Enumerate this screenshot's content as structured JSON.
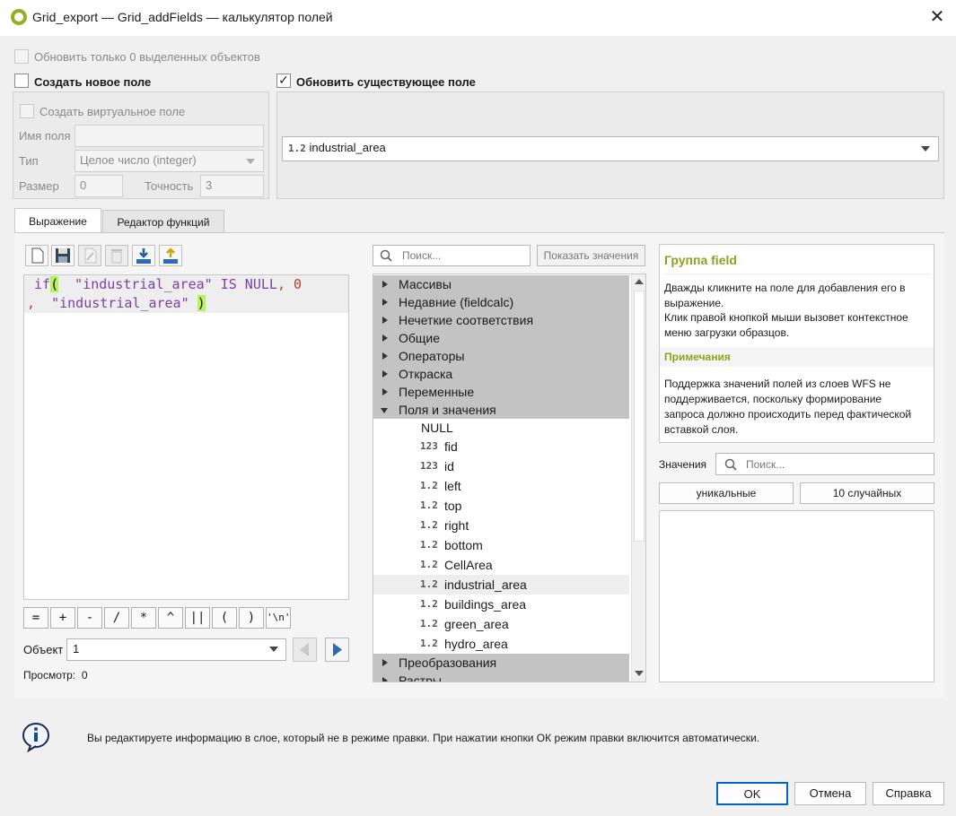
{
  "window": {
    "title": "Grid_export — Grid_addFields — калькулятор полей",
    "close_glyph": "✕"
  },
  "top": {
    "update_selected_label": "Обновить только 0 выделенных объектов",
    "create_new_field_label": "Создать новое поле",
    "update_existing_label": "Обновить существующее поле",
    "update_existing_checkmark": "✓"
  },
  "new_field": {
    "virtual_label": "Создать виртуальное поле",
    "name_label": "Имя поля",
    "name_value": "",
    "type_label": "Тип",
    "type_value": "Целое число (integer)",
    "size_label": "Размер",
    "size_value": "0",
    "precision_label": "Точность",
    "precision_value": "3"
  },
  "existing_field": {
    "type_badge": "1.2",
    "value": "industrial_area"
  },
  "tabs": [
    {
      "label": "Выражение"
    },
    {
      "label": "Редактор функций"
    }
  ],
  "expression": {
    "line1": {
      "kw": "if",
      "paren": "(",
      "arg": "\"industrial_area\"",
      "is_null": "IS NULL",
      "comma": ",",
      "zero": "0"
    },
    "line2": {
      "comma": ",",
      "arg": "\"industrial_area\"",
      "paren": ")"
    }
  },
  "operators": [
    "=",
    "+",
    "-",
    "/",
    "*",
    "^",
    "||",
    "(",
    ")",
    "'\\n'"
  ],
  "feature": {
    "label": "Объект",
    "value": "1"
  },
  "preview": {
    "label": "Просмотр:",
    "value": "0"
  },
  "function_search": {
    "placeholder": "Поиск...",
    "show_values_label": "Показать значения"
  },
  "tree": {
    "groups_top": [
      "Массивы",
      "Недавние (fieldcalc)",
      "Нечеткие соответствия",
      "Общие",
      "Операторы",
      "Откраска",
      "Переменные"
    ],
    "open_group": "Поля и значения",
    "fields": [
      {
        "type": "",
        "name": "NULL"
      },
      {
        "type": "123",
        "name": "fid"
      },
      {
        "type": "123",
        "name": "id"
      },
      {
        "type": "1.2",
        "name": "left"
      },
      {
        "type": "1.2",
        "name": "top"
      },
      {
        "type": "1.2",
        "name": "right"
      },
      {
        "type": "1.2",
        "name": "bottom"
      },
      {
        "type": "1.2",
        "name": "CellArea"
      },
      {
        "type": "1.2",
        "name": "industrial_area"
      },
      {
        "type": "1.2",
        "name": "buildings_area"
      },
      {
        "type": "1.2",
        "name": "green_area"
      },
      {
        "type": "1.2",
        "name": "hydro_area"
      }
    ],
    "groups_bottom": [
      "Преобразования",
      "Растры"
    ]
  },
  "help": {
    "title": "Группа field",
    "text1": "Дважды кликните на поле для добавления его в выражение.",
    "text2": "Клик правой кнопкой мыши вызовет контекстное меню загрузки образцов.",
    "notes_title": "Примечания",
    "notes_text": "Поддержка значений полей из слоев WFS не поддерживается, поскольку формирование запроса должно происходить перед фактической вставкой слоя."
  },
  "values": {
    "label": "Значения",
    "search_placeholder": "Поиск...",
    "unique_label": "уникальные",
    "random_label": "10 случайных"
  },
  "info": {
    "message": "Вы редактируете информацию в слое, который не в режиме правки. При нажатии кнопки ОК режим правки включится автоматически."
  },
  "buttons": {
    "ok": "OK",
    "cancel": "Отмена",
    "help": "Справка"
  },
  "colors": {
    "accent_green": "#93b023",
    "code_purple": "#7b3fa6",
    "code_red": "#c0392b",
    "bracket_highlight": "#b6f25a",
    "ok_border": "#0067c0"
  }
}
